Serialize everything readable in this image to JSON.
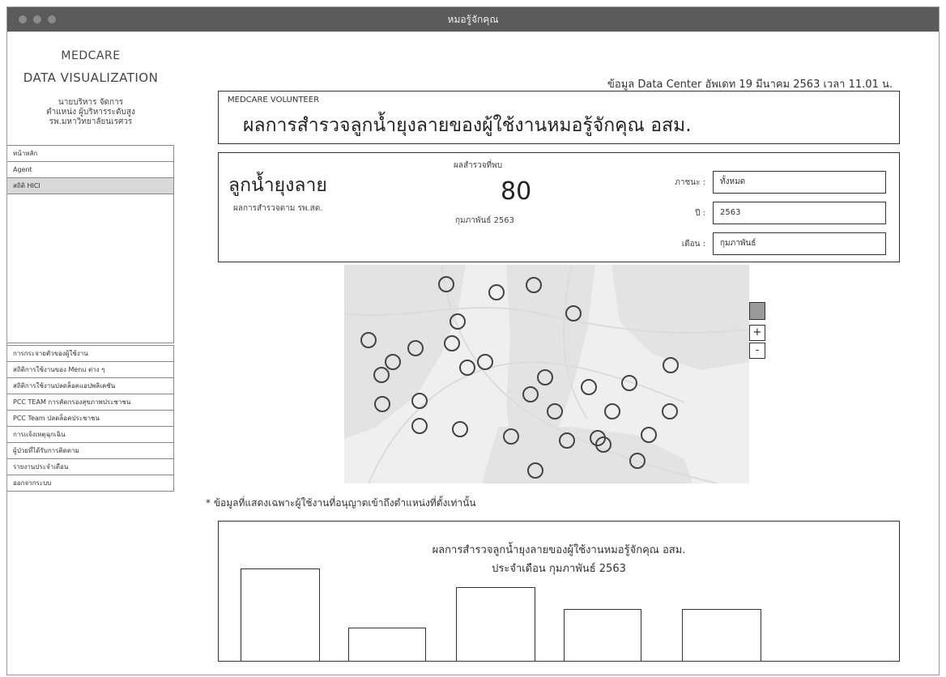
{
  "window": {
    "title": "หมอรู้จักคุณ"
  },
  "sidebar": {
    "brand_line1": "MEDCARE",
    "brand_line2": "DATA VISUALIZATION",
    "user_lines": [
      "นายบริหาร จัดการ",
      "ตำแหน่ง ผู้บริหารระดับสูง",
      "รพ.มหาวิทยาลัยนเรศวร"
    ],
    "top_items": [
      {
        "label": "หน้าหลัก"
      },
      {
        "label": "Agent"
      },
      {
        "label": "สถิติ HICI"
      }
    ],
    "bottom_items": [
      {
        "label": "การกระจายตัวของผู้ใช้งาน"
      },
      {
        "label": "สถิติการใช้งานของ Menu ต่าง ๆ"
      },
      {
        "label": "สถิติการใช้งานปลดล็อคแอปพลิเคชัน"
      },
      {
        "label": "PCC TEAM การคัดกรองสุขภาพประชาชน"
      },
      {
        "label": "PCC Team ปลดล็อคประชาชน"
      },
      {
        "label": "การแจ้งเหตุฉุกเฉิน"
      },
      {
        "label": "ผู้ป่วยที่ได้รับการติดตาม"
      },
      {
        "label": "รายงานประจำเดือน"
      },
      {
        "label": "ออกจากระบบ"
      }
    ]
  },
  "header": {
    "updated_text": "ข้อมูล Data Center อัพเดท 19 มีนาคม 2563 เวลา 11.01 น."
  },
  "volunteer": {
    "label": "MEDCARE VOLUNTEER",
    "title": "ผลการสำรวจลูกน้ำยุงลายของผู้ใช้งานหมอรู้จักคุณ อสม."
  },
  "summary": {
    "title": "ลูกน้ำยุงลาย",
    "subtitle": "ผลการสำรวจตาม รพ.สต.",
    "found_label": "ผลสำรวจที่พบ",
    "found_value": "80",
    "found_month": "กุมภาพันธ์ 2563"
  },
  "filters": {
    "container_label": "ภาชนะ :",
    "container_value": "ทั้งหมด",
    "year_label": "ปี :",
    "year_value": "2563",
    "month_label": "เดือน :",
    "month_value": "กุมภาพันธ์"
  },
  "map": {
    "zoom_in": "+",
    "zoom_out": "-",
    "marker_count": 31
  },
  "note": "* ข้อมูลที่แสดงเฉพาะผู้ใช้งานที่อนุญาตเข้าถึงตำแหน่งที่ตั้งเท่านั้น",
  "chart_data": {
    "type": "bar",
    "title": "ผลการสำรวจลูกน้ำยุงลายของผู้ใช้งานหมอรู้จักคุณ อสม.",
    "subtitle": "ประจำเดือน กุมภาพันธ์ 2563",
    "categories": [
      "",
      "",
      "",
      "",
      ""
    ],
    "values": [
      100,
      36,
      80,
      56,
      56
    ],
    "ylim": [
      0,
      100
    ],
    "grid": false,
    "axes_labels": false
  }
}
